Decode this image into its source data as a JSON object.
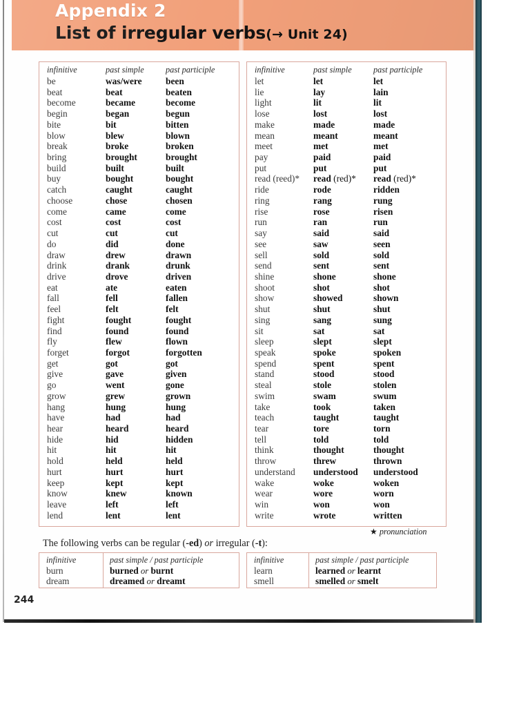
{
  "header": {
    "appendix_label": "Appendix 2",
    "title": "List of irregular verbs",
    "reference": "(→ Unit 24)"
  },
  "columns": {
    "infinitive": "infinitive",
    "past_simple": "past simple",
    "past_participle": "past participle",
    "past_simple_participle": "past simple / past participle"
  },
  "table_left": [
    [
      "be",
      "was/were",
      "been"
    ],
    [
      "beat",
      "beat",
      "beaten"
    ],
    [
      "become",
      "became",
      "become"
    ],
    [
      "begin",
      "began",
      "begun"
    ],
    [
      "bite",
      "bit",
      "bitten"
    ],
    [
      "blow",
      "blew",
      "blown"
    ],
    [
      "break",
      "broke",
      "broken"
    ],
    [
      "bring",
      "brought",
      "brought"
    ],
    [
      "build",
      "built",
      "built"
    ],
    [
      "buy",
      "bought",
      "bought"
    ],
    [
      "catch",
      "caught",
      "caught"
    ],
    [
      "choose",
      "chose",
      "chosen"
    ],
    [
      "come",
      "came",
      "come"
    ],
    [
      "cost",
      "cost",
      "cost"
    ],
    [
      "cut",
      "cut",
      "cut"
    ],
    [
      "do",
      "did",
      "done"
    ],
    [
      "draw",
      "drew",
      "drawn"
    ],
    [
      "drink",
      "drank",
      "drunk"
    ],
    [
      "drive",
      "drove",
      "driven"
    ],
    [
      "eat",
      "ate",
      "eaten"
    ],
    [
      "fall",
      "fell",
      "fallen"
    ],
    [
      "feel",
      "felt",
      "felt"
    ],
    [
      "fight",
      "fought",
      "fought"
    ],
    [
      "find",
      "found",
      "found"
    ],
    [
      "fly",
      "flew",
      "flown"
    ],
    [
      "forget",
      "forgot",
      "forgotten"
    ],
    [
      "get",
      "got",
      "got"
    ],
    [
      "give",
      "gave",
      "given"
    ],
    [
      "go",
      "went",
      "gone"
    ],
    [
      "grow",
      "grew",
      "grown"
    ],
    [
      "hang",
      "hung",
      "hung"
    ],
    [
      "have",
      "had",
      "had"
    ],
    [
      "hear",
      "heard",
      "heard"
    ],
    [
      "hide",
      "hid",
      "hidden"
    ],
    [
      "hit",
      "hit",
      "hit"
    ],
    [
      "hold",
      "held",
      "held"
    ],
    [
      "hurt",
      "hurt",
      "hurt"
    ],
    [
      "keep",
      "kept",
      "kept"
    ],
    [
      "know",
      "knew",
      "known"
    ],
    [
      "leave",
      "left",
      "left"
    ],
    [
      "lend",
      "lent",
      "lent"
    ]
  ],
  "table_right": [
    [
      "let",
      "let",
      "let"
    ],
    [
      "lie",
      "lay",
      "lain"
    ],
    [
      "light",
      "lit",
      "lit"
    ],
    [
      "lose",
      "lost",
      "lost"
    ],
    [
      "make",
      "made",
      "made"
    ],
    [
      "mean",
      "meant",
      "meant"
    ],
    [
      "meet",
      "met",
      "met"
    ],
    [
      "pay",
      "paid",
      "paid"
    ],
    [
      "put",
      "put",
      "put"
    ],
    [
      "read (reed)*",
      "read (red)*",
      "read (red)*"
    ],
    [
      "ride",
      "rode",
      "ridden"
    ],
    [
      "ring",
      "rang",
      "rung"
    ],
    [
      "rise",
      "rose",
      "risen"
    ],
    [
      "run",
      "ran",
      "run"
    ],
    [
      "say",
      "said",
      "said"
    ],
    [
      "see",
      "saw",
      "seen"
    ],
    [
      "sell",
      "sold",
      "sold"
    ],
    [
      "send",
      "sent",
      "sent"
    ],
    [
      "shine",
      "shone",
      "shone"
    ],
    [
      "shoot",
      "shot",
      "shot"
    ],
    [
      "show",
      "showed",
      "shown"
    ],
    [
      "shut",
      "shut",
      "shut"
    ],
    [
      "sing",
      "sang",
      "sung"
    ],
    [
      "sit",
      "sat",
      "sat"
    ],
    [
      "sleep",
      "slept",
      "slept"
    ],
    [
      "speak",
      "spoke",
      "spoken"
    ],
    [
      "spend",
      "spent",
      "spent"
    ],
    [
      "stand",
      "stood",
      "stood"
    ],
    [
      "steal",
      "stole",
      "stolen"
    ],
    [
      "swim",
      "swam",
      "swum"
    ],
    [
      "take",
      "took",
      "taken"
    ],
    [
      "teach",
      "taught",
      "taught"
    ],
    [
      "tear",
      "tore",
      "torn"
    ],
    [
      "tell",
      "told",
      "told"
    ],
    [
      "think",
      "thought",
      "thought"
    ],
    [
      "throw",
      "threw",
      "thrown"
    ],
    [
      "understand",
      "understood",
      "understood"
    ],
    [
      "wake",
      "woke",
      "woken"
    ],
    [
      "wear",
      "wore",
      "worn"
    ],
    [
      "win",
      "won",
      "won"
    ],
    [
      "write",
      "wrote",
      "written"
    ]
  ],
  "footnote": {
    "star": "★",
    "text": "pronunciation"
  },
  "intro_note": {
    "part1": "The following verbs can be regular (",
    "ed": "-ed",
    "part2": ") ",
    "or": "or",
    "part3": " irregular (",
    "t": "-t",
    "part4": "):"
  },
  "regular_left": [
    {
      "infinitive": "burn",
      "forms": [
        "burned",
        "or",
        "burnt"
      ]
    },
    {
      "infinitive": "dream",
      "forms": [
        "dreamed",
        "or",
        "dreamt"
      ]
    }
  ],
  "regular_right": [
    {
      "infinitive": "learn",
      "forms": [
        "learned",
        "or",
        "learnt"
      ]
    },
    {
      "infinitive": "smell",
      "forms": [
        "smelled",
        "or",
        "smelt"
      ]
    }
  ],
  "page_number": "244",
  "colors": {
    "banner": "#f2a07a",
    "table_border": "#d9a69c",
    "spine": "#2d5560",
    "appendix_text": "#ffffff",
    "title_text": "#121212"
  }
}
